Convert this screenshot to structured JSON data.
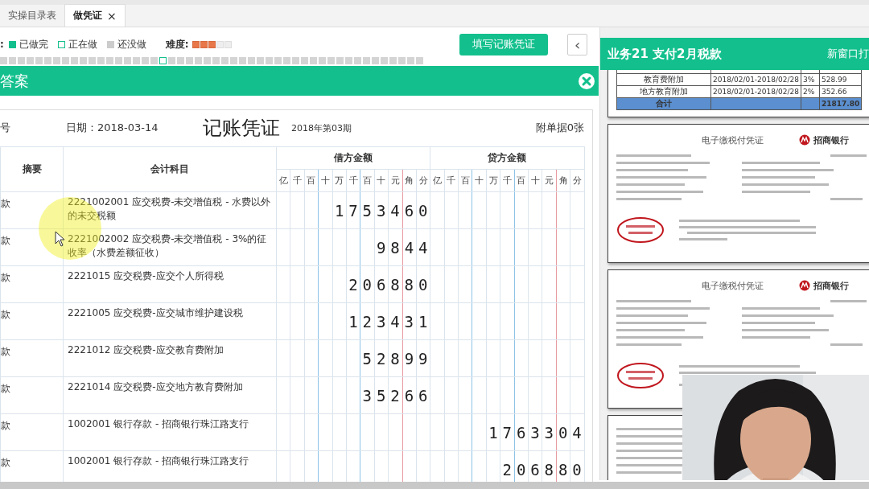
{
  "tabs": [
    {
      "label": "实操目录表",
      "selected": false
    },
    {
      "label": "做凭证",
      "selected": true,
      "close": "×"
    }
  ],
  "legend": {
    "prefix": ":",
    "items": [
      {
        "label": "已做完",
        "kind": "done"
      },
      {
        "label": "正在做",
        "kind": "doing"
      },
      {
        "label": "还没做",
        "kind": "todo"
      }
    ]
  },
  "difficulty": {
    "label": "难度:",
    "stars": 3
  },
  "fill_button": "填写记账凭证",
  "back_button": "‹",
  "steps": [
    {
      "selected": false
    },
    {
      "selected": false
    },
    {
      "selected": false
    },
    {
      "selected": false
    },
    {
      "selected": false
    },
    {
      "selected": false
    },
    {
      "selected": false
    },
    {
      "selected": false
    },
    {
      "selected": false
    },
    {
      "selected": false
    },
    {
      "selected": false
    },
    {
      "selected": false
    },
    {
      "selected": false
    },
    {
      "selected": false
    },
    {
      "selected": false
    },
    {
      "selected": false
    },
    {
      "selected": false
    },
    {
      "selected": false
    },
    {
      "selected": true
    },
    {
      "selected": false
    },
    {
      "selected": false
    },
    {
      "selected": false
    },
    {
      "selected": false
    },
    {
      "selected": false
    },
    {
      "selected": false
    },
    {
      "selected": false
    },
    {
      "selected": false
    },
    {
      "selected": false
    },
    {
      "selected": false
    },
    {
      "selected": false
    },
    {
      "selected": false
    },
    {
      "selected": false
    },
    {
      "selected": false
    },
    {
      "selected": false
    },
    {
      "selected": false
    },
    {
      "selected": false
    },
    {
      "selected": false
    },
    {
      "selected": false
    },
    {
      "selected": false
    },
    {
      "selected": false
    },
    {
      "selected": false
    },
    {
      "selected": false
    },
    {
      "selected": false
    },
    {
      "selected": false
    },
    {
      "selected": false
    },
    {
      "selected": false
    },
    {
      "selected": false
    },
    {
      "selected": false
    }
  ],
  "answer_bar": {
    "title": "答案"
  },
  "voucher": {
    "number_label": "号",
    "date": "日期：2018-03-14",
    "title": "记账凭证",
    "period": "2018年第03期",
    "attachments": "附单据0张",
    "headers": {
      "summary": "摘要",
      "account": "会计科目",
      "debit": "借方金额",
      "credit": "贷方金额"
    },
    "digit_units": [
      "亿",
      "千",
      "百",
      "十",
      "万",
      "千",
      "百",
      "十",
      "元",
      "角",
      "分"
    ],
    "credit_units": [
      "亿",
      "千",
      "百",
      "十",
      "万",
      "千",
      "百",
      "十",
      "元",
      "角",
      "分"
    ],
    "rows": [
      {
        "summary": "款",
        "account": "2221002001 应交税费-未交增值税 - 水费以外的未交税额",
        "debit": "1753460"
      },
      {
        "summary": "款",
        "account": "2221002002 应交税费-未交增值税 - 3%的征收率（水费差额征收）",
        "debit": "9844"
      },
      {
        "summary": "款",
        "account": "2221015 应交税费-应交个人所得税",
        "debit": "206880"
      },
      {
        "summary": "款",
        "account": "2221005 应交税费-应交城市维护建设税",
        "debit": "123431"
      },
      {
        "summary": "款",
        "account": "2221012 应交税费-应交教育费附加",
        "debit": "52899"
      },
      {
        "summary": "款",
        "account": "2221014 应交税费-应交地方教育费附加",
        "debit": "35266"
      },
      {
        "summary": "款",
        "account": "1002001 银行存款 - 招商银行珠江路支行",
        "credit": "1763304"
      },
      {
        "summary": "款",
        "account": "1002001 银行存款 - 招商银行珠江路支行",
        "credit": "206880"
      }
    ]
  },
  "task_panel": {
    "title": "业务21 支付2月税款",
    "open_new": "新窗口打",
    "tax_table": {
      "rows": [
        {
          "item": "教育费附加",
          "period": "2018/02/01-2018/02/28",
          "rate": "3%",
          "amount": "528.99"
        },
        {
          "item": "地方教育附加",
          "period": "2018/02/01-2018/02/28",
          "rate": "2%",
          "amount": "352.66"
        }
      ],
      "total": {
        "label": "合计",
        "amount": "21817.80"
      }
    },
    "receipts": [
      {
        "kind": "full",
        "title": "电子缴税付凭证",
        "bank": "招商银行"
      },
      {
        "kind": "full",
        "title": "电子缴税付凭证",
        "bank": "招商银行"
      },
      {
        "kind": "partial"
      }
    ]
  }
}
